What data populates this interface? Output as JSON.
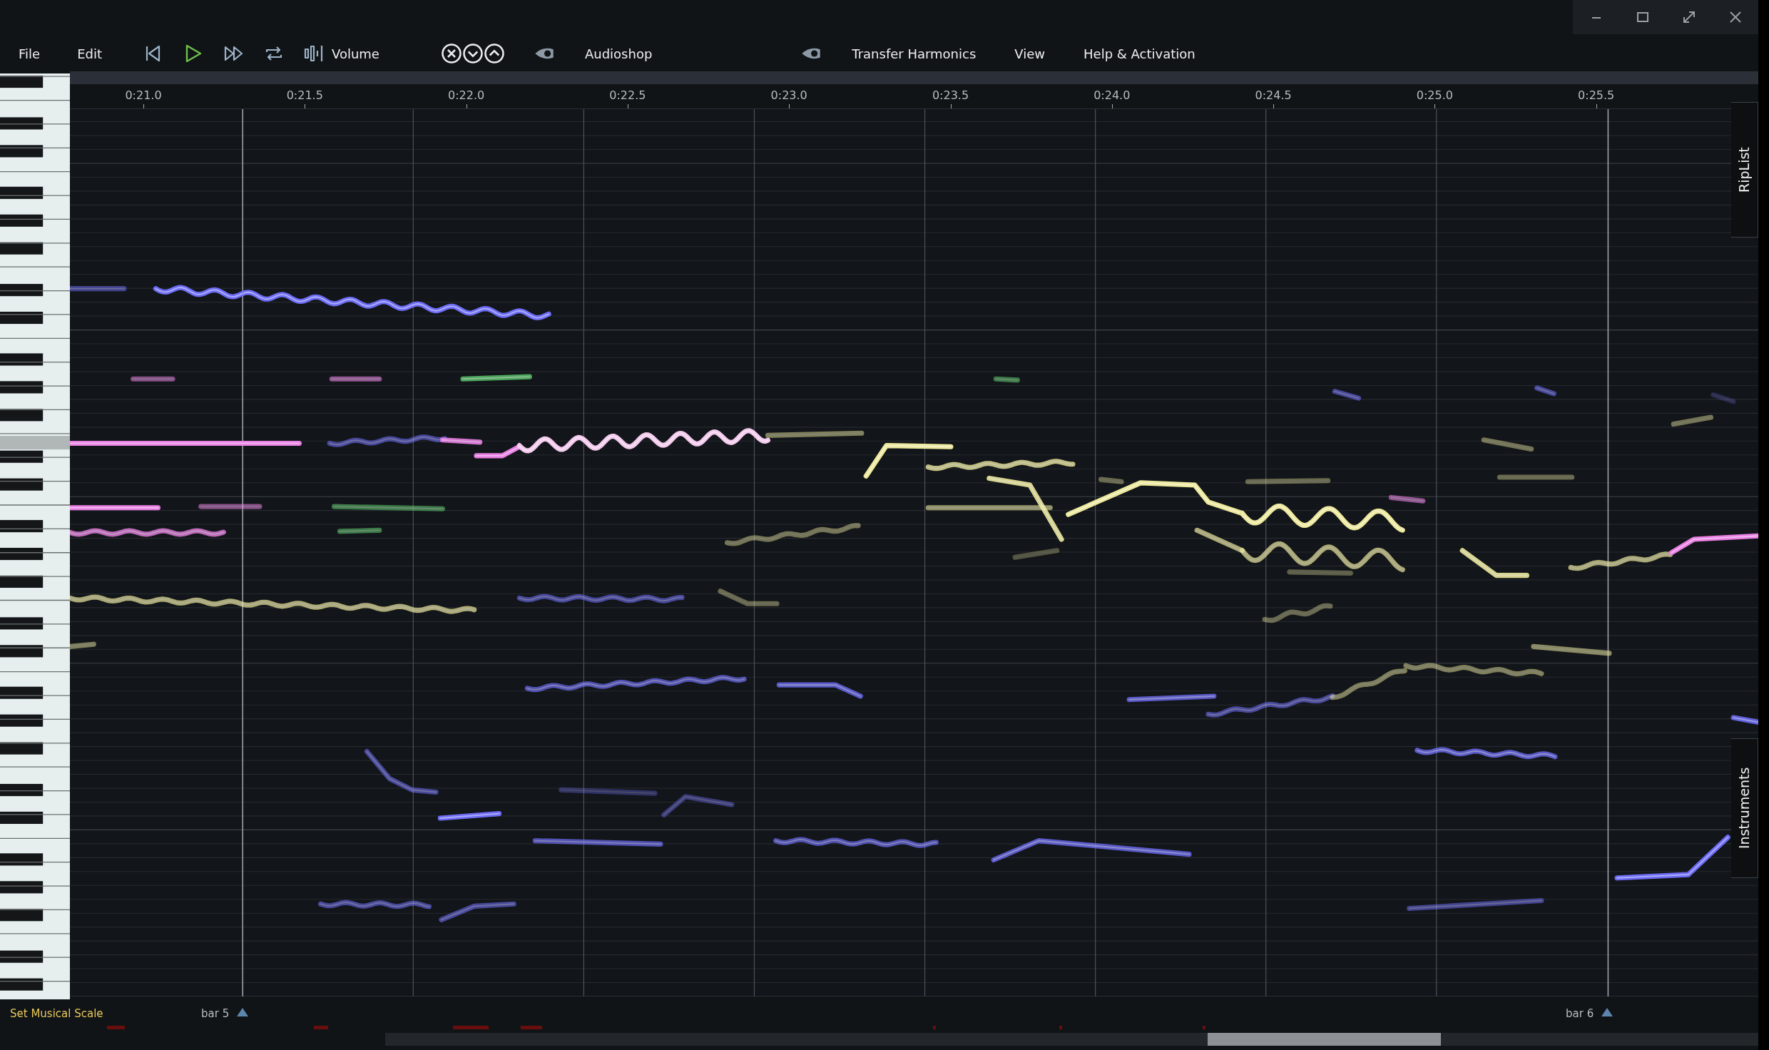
{
  "menu_left": [
    "File",
    "Edit"
  ],
  "volume_label": "Volume",
  "audioshop_label": "Audioshop",
  "menu_right": [
    "Transfer Harmonics",
    "View",
    "Help & Activation"
  ],
  "ruler": {
    "labels": [
      "0:21.0",
      "0:21.5",
      "0:22.0",
      "0:22.5",
      "0:23.0",
      "0:23.5",
      "0:24.0",
      "0:24.5",
      "0:25.0",
      "0:25.5"
    ]
  },
  "side_tabs": [
    "RipList",
    "Instruments"
  ],
  "footer": {
    "scale_button": "Set Musical Scale",
    "markers": [
      "bar 5",
      "bar 6"
    ]
  }
}
